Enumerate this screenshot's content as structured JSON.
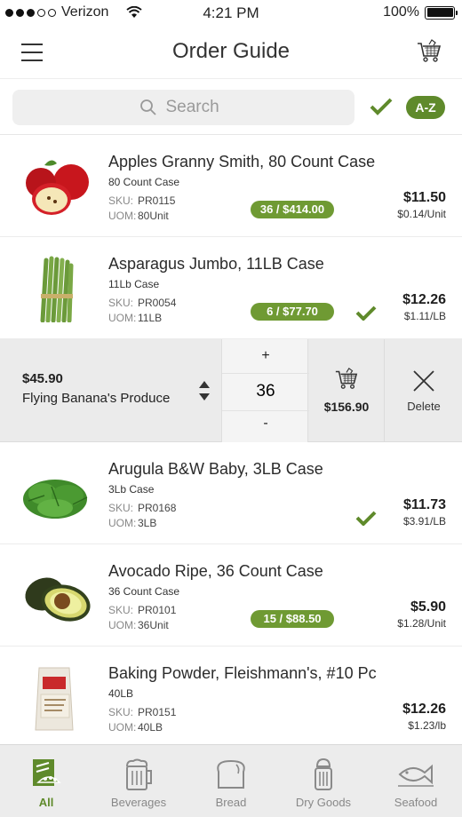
{
  "status_bar": {
    "carrier": "Verizon",
    "time": "4:21 PM",
    "battery": "100%"
  },
  "nav": {
    "title": "Order Guide",
    "menu_icon": "hamburger-icon",
    "cart_icon": "cart-icon"
  },
  "search": {
    "placeholder": "Search",
    "az_label": "A-Z"
  },
  "colors": {
    "accent": "#5f8a2b",
    "badge": "#6f9a33"
  },
  "items": [
    {
      "name": "Apples Granny Smith, 80 Count Case",
      "pack": "80 Count Case",
      "sku_label": "SKU:",
      "sku": "PR0115",
      "uom_label": "UOM:",
      "uom": "80Unit",
      "badge": "36 / $414.00",
      "checked": false,
      "price": "$11.50",
      "unit_price": "$0.14/Unit"
    },
    {
      "name": "Asparagus Jumbo, 11LB Case",
      "pack": "11Lb Case",
      "sku_label": "SKU:",
      "sku": "PR0054",
      "uom_label": "UOM:",
      "uom": "11LB",
      "badge": "6 / $77.70",
      "checked": true,
      "price": "$12.26",
      "unit_price": "$1.11/LB"
    },
    {
      "name": "Arugula B&W Baby, 3LB Case",
      "pack": "3Lb Case",
      "sku_label": "SKU:",
      "sku": "PR0168",
      "uom_label": "UOM:",
      "uom": "3LB",
      "badge": "",
      "checked": true,
      "price": "$11.73",
      "unit_price": "$3.91/LB"
    },
    {
      "name": "Avocado Ripe, 36 Count Case",
      "pack": "36 Count Case",
      "sku_label": "SKU:",
      "sku": "PR0101",
      "uom_label": "UOM:",
      "uom": "36Unit",
      "badge": "15 / $88.50",
      "checked": false,
      "price": "$5.90",
      "unit_price": "$1.28/Unit"
    },
    {
      "name": "Baking Powder, Fleishmann's, #10 Pc",
      "pack": "40LB",
      "sku_label": "SKU:",
      "sku": "PR0151",
      "uom_label": "UOM:",
      "uom": "40LB",
      "badge": "",
      "checked": false,
      "price": "$12.26",
      "unit_price": "$1.23/lb"
    }
  ],
  "expanded": {
    "vendor_price": "$45.90",
    "vendor_name": "Flying Banana's Produce",
    "plus": "+",
    "quantity": "36",
    "minus": "-",
    "total": "$156.90",
    "delete_label": "Delete"
  },
  "tabs": [
    {
      "label": "All",
      "icon": "all-icon",
      "active": true
    },
    {
      "label": "Beverages",
      "icon": "beer-mug-icon",
      "active": false
    },
    {
      "label": "Bread",
      "icon": "bread-icon",
      "active": false
    },
    {
      "label": "Dry Goods",
      "icon": "salt-shaker-icon",
      "active": false
    },
    {
      "label": "Seafood",
      "icon": "fish-icon",
      "active": false
    }
  ]
}
